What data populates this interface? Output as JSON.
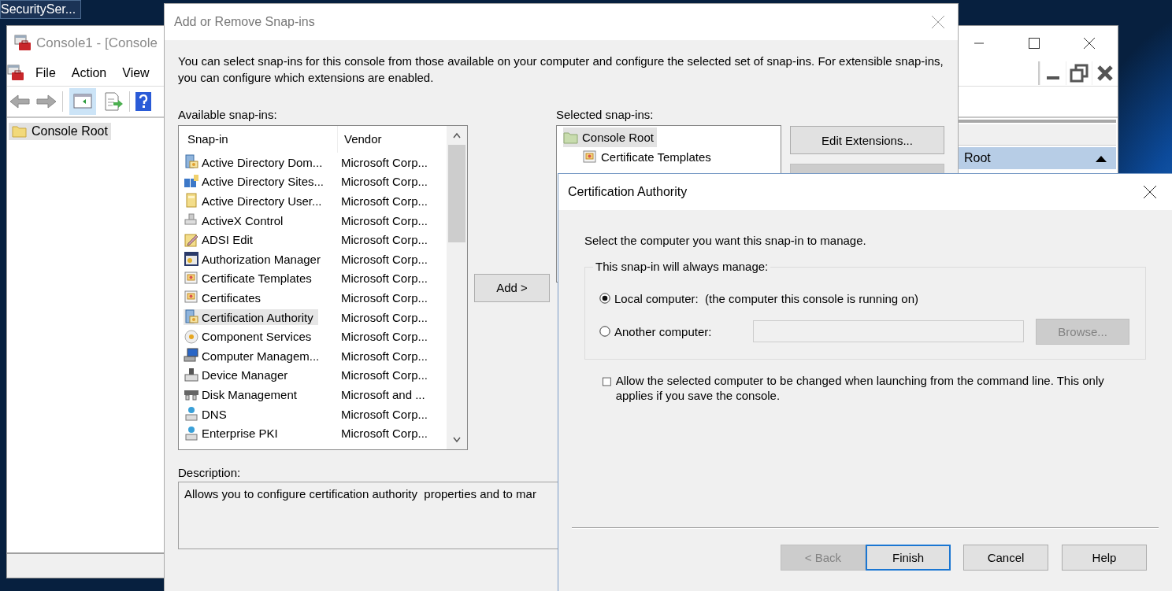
{
  "desktop": {
    "taskbar_item": "SecuritySer..."
  },
  "console_window": {
    "title": "Console1 - [Console",
    "menu": [
      "File",
      "Action",
      "View"
    ],
    "tree": [
      {
        "label": "Console Root",
        "selected": true
      }
    ],
    "actions_header": "Root"
  },
  "snapins_dialog": {
    "title": "Add or Remove Snap-ins",
    "intro": "You can select snap-ins for this console from those available on your computer and configure the selected set of snap-ins. For extensible snap-ins, you can configure which extensions are enabled.",
    "available_label": "Available snap-ins:",
    "columns": [
      "Snap-in",
      "Vendor"
    ],
    "rows": [
      {
        "name": "Active Directory Dom...",
        "vendor": "Microsoft Corp...",
        "selected": false
      },
      {
        "name": "Active Directory Sites...",
        "vendor": "Microsoft Corp...",
        "selected": false
      },
      {
        "name": "Active Directory User...",
        "vendor": "Microsoft Corp...",
        "selected": false
      },
      {
        "name": "ActiveX Control",
        "vendor": "Microsoft Corp...",
        "selected": false
      },
      {
        "name": "ADSI Edit",
        "vendor": "Microsoft Corp...",
        "selected": false
      },
      {
        "name": "Authorization Manager",
        "vendor": "Microsoft Corp...",
        "selected": false
      },
      {
        "name": "Certificate Templates",
        "vendor": "Microsoft Corp...",
        "selected": false
      },
      {
        "name": "Certificates",
        "vendor": "Microsoft Corp...",
        "selected": false
      },
      {
        "name": "Certification Authority",
        "vendor": "Microsoft Corp...",
        "selected": true
      },
      {
        "name": "Component Services",
        "vendor": "Microsoft Corp...",
        "selected": false
      },
      {
        "name": "Computer Managem...",
        "vendor": "Microsoft Corp...",
        "selected": false
      },
      {
        "name": "Device Manager",
        "vendor": "Microsoft Corp...",
        "selected": false
      },
      {
        "name": "Disk Management",
        "vendor": "Microsoft and ...",
        "selected": false
      },
      {
        "name": "DNS",
        "vendor": "Microsoft Corp...",
        "selected": false
      },
      {
        "name": "Enterprise PKI",
        "vendor": "Microsoft Corp...",
        "selected": false
      }
    ],
    "add_button": "Add >",
    "selected_label": "Selected snap-ins:",
    "selected_tree": [
      {
        "label": "Console Root",
        "selected": true,
        "children": [
          {
            "label": "Certificate Templates",
            "selected": false
          }
        ]
      }
    ],
    "side_buttons": [
      {
        "label": "Edit Extensions...",
        "disabled": false
      },
      {
        "disabled": true
      }
    ],
    "description_label": "Description:",
    "description": "Allows you to configure certification authority  properties and to mar"
  },
  "ca_dialog": {
    "title": "Certification Authority",
    "prompt": "Select the computer you want this snap-in to manage.",
    "group_label": "This snap-in will always manage:",
    "options": [
      {
        "label": "Local computer:  (the computer this console is running on)",
        "selected": true
      },
      {
        "label": "Another computer:",
        "selected": false
      }
    ],
    "browse_button": {
      "label": "Browse...",
      "disabled": true
    },
    "allow_change": {
      "label": "Allow the selected computer to be changed when launching from the command line. This only applies if you save the console.",
      "checked": false
    },
    "buttons": [
      {
        "label": "< Back",
        "disabled": true,
        "default": false
      },
      {
        "label": "Finish",
        "disabled": false,
        "default": true
      },
      {
        "label": "Cancel",
        "disabled": false,
        "default": false
      },
      {
        "label": "Help",
        "disabled": false,
        "default": false
      }
    ]
  }
}
